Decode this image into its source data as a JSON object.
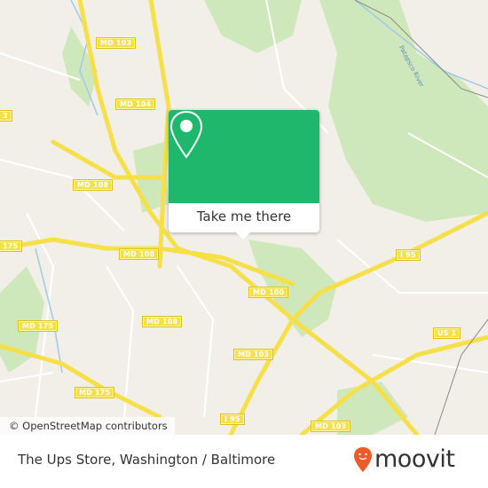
{
  "map": {
    "attribution": "© OpenStreetMap contributors",
    "road_labels": [
      "MD 103",
      "MD 104",
      "3",
      "MD 108",
      "175",
      "MD 108",
      "MD 108",
      "MD 175",
      "MD 175",
      "MD 100",
      "MD 103",
      "I 95",
      "US 1",
      "I 95",
      "MD 103"
    ],
    "river_label": "Patapsco River",
    "colors": {
      "land": "#f2efe9",
      "park": "#c8e6b0",
      "highway": "#f6e04a",
      "water": "#9ecbe8"
    }
  },
  "popup": {
    "icon": "map-pin-icon",
    "button_label": "Take me there",
    "color": "#1fb76b"
  },
  "footer": {
    "title": "The Ups Store, Washington / Baltimore",
    "brand": "moovit",
    "brand_color": "#f05a28"
  }
}
